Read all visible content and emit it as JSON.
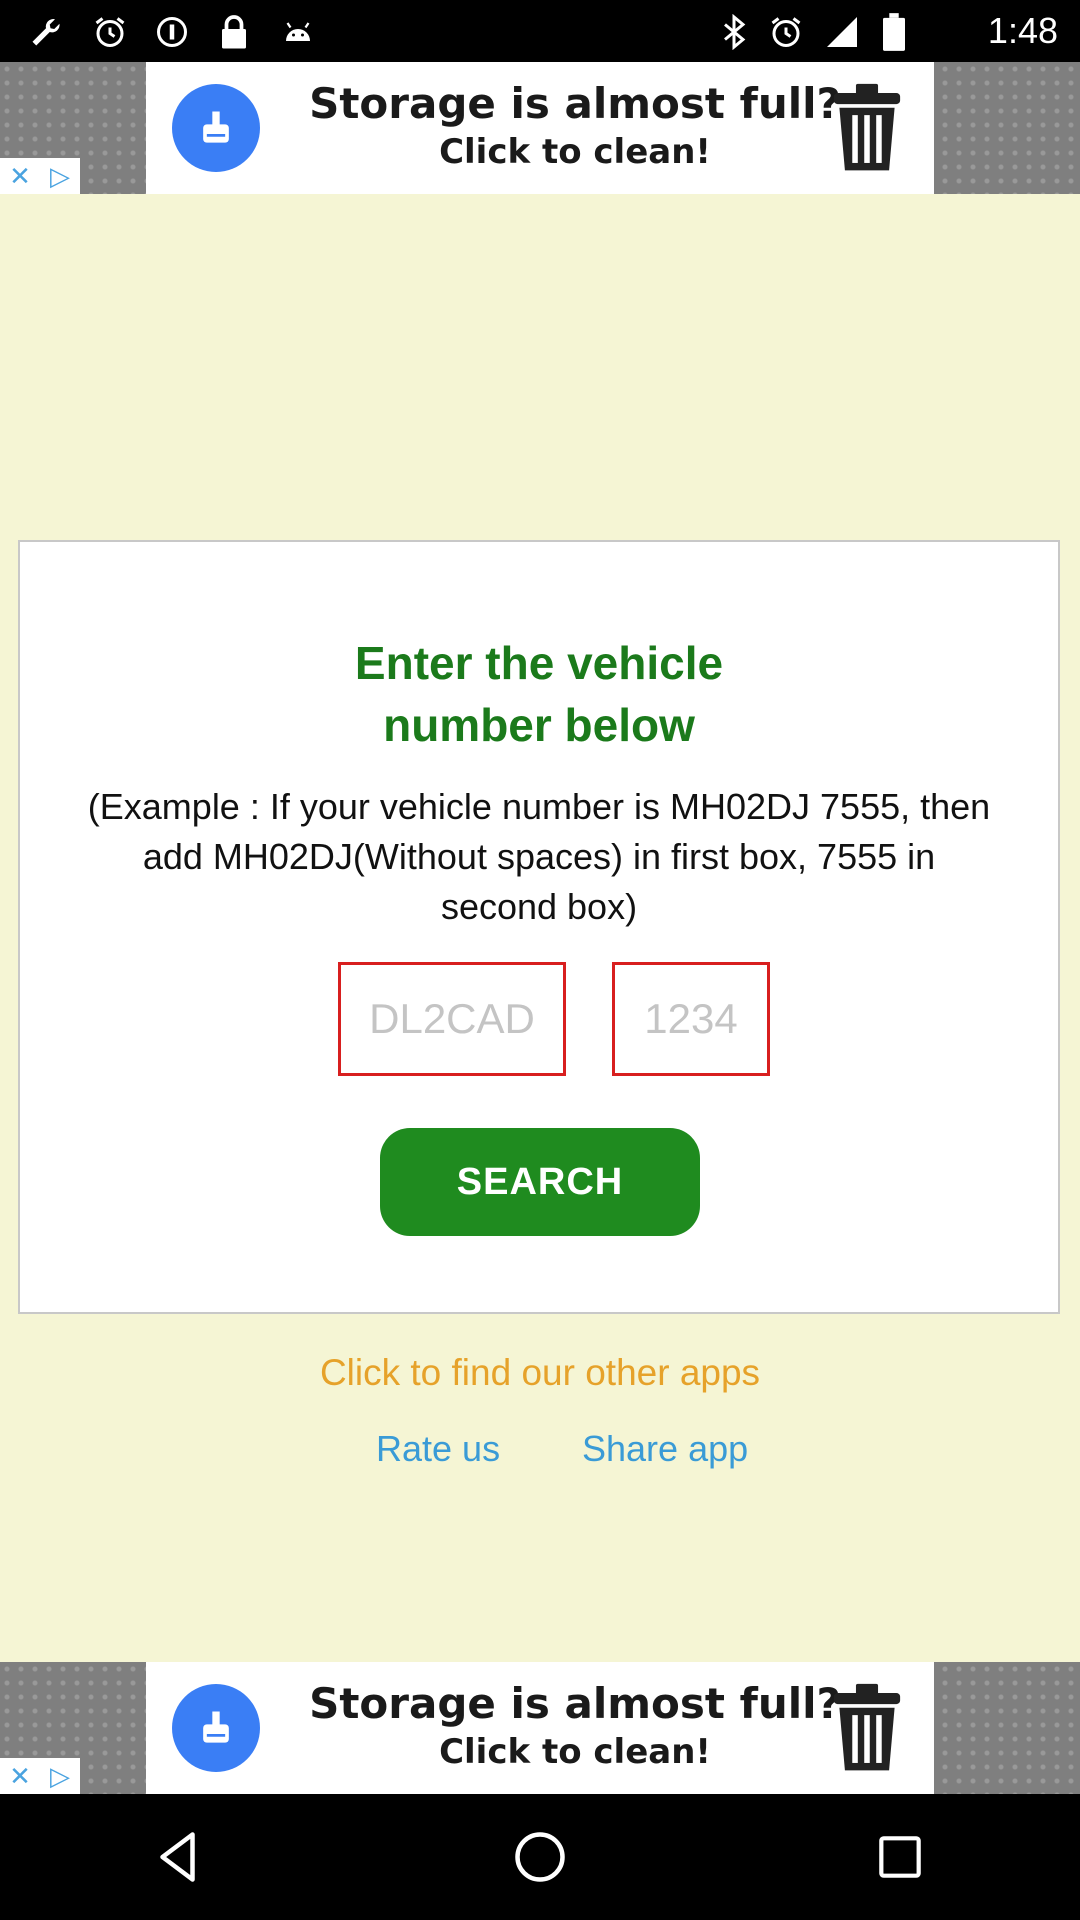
{
  "status_bar": {
    "time": "1:48",
    "left_icons": [
      "wrench-icon",
      "alarm-icon",
      "data-saver-icon",
      "lock-icon",
      "android-icon"
    ],
    "right_icons": [
      "bluetooth-icon",
      "alarm-icon"
    ]
  },
  "ads": {
    "top": {
      "line1": "Storage is almost full?",
      "line2": "Click to clean!"
    },
    "bottom": {
      "line1": "Storage is almost full?",
      "line2": "Click to clean!"
    }
  },
  "card": {
    "title": "Enter the vehicle number below",
    "example": "(Example : If your vehicle number is MH02DJ 7555, then add MH02DJ(Without spaces) in first box, 7555 in second box)",
    "first_box": {
      "value": "",
      "placeholder": "DL2CAD"
    },
    "second_box": {
      "value": "",
      "placeholder": "1234"
    },
    "search_label": "SEARCH"
  },
  "links": {
    "other_apps": "Click to find our other apps",
    "rate_us": "Rate us",
    "share_app": "Share app"
  },
  "colors": {
    "background": "#f5f5d4",
    "title_green": "#1b7a1b",
    "button_green": "#1f8b1f",
    "input_border_red": "#d81f1f",
    "link_orange": "#e6a22a",
    "link_blue": "#3a9bd6"
  },
  "nav": {
    "icons": [
      "back-icon",
      "home-icon",
      "recents-icon"
    ]
  }
}
